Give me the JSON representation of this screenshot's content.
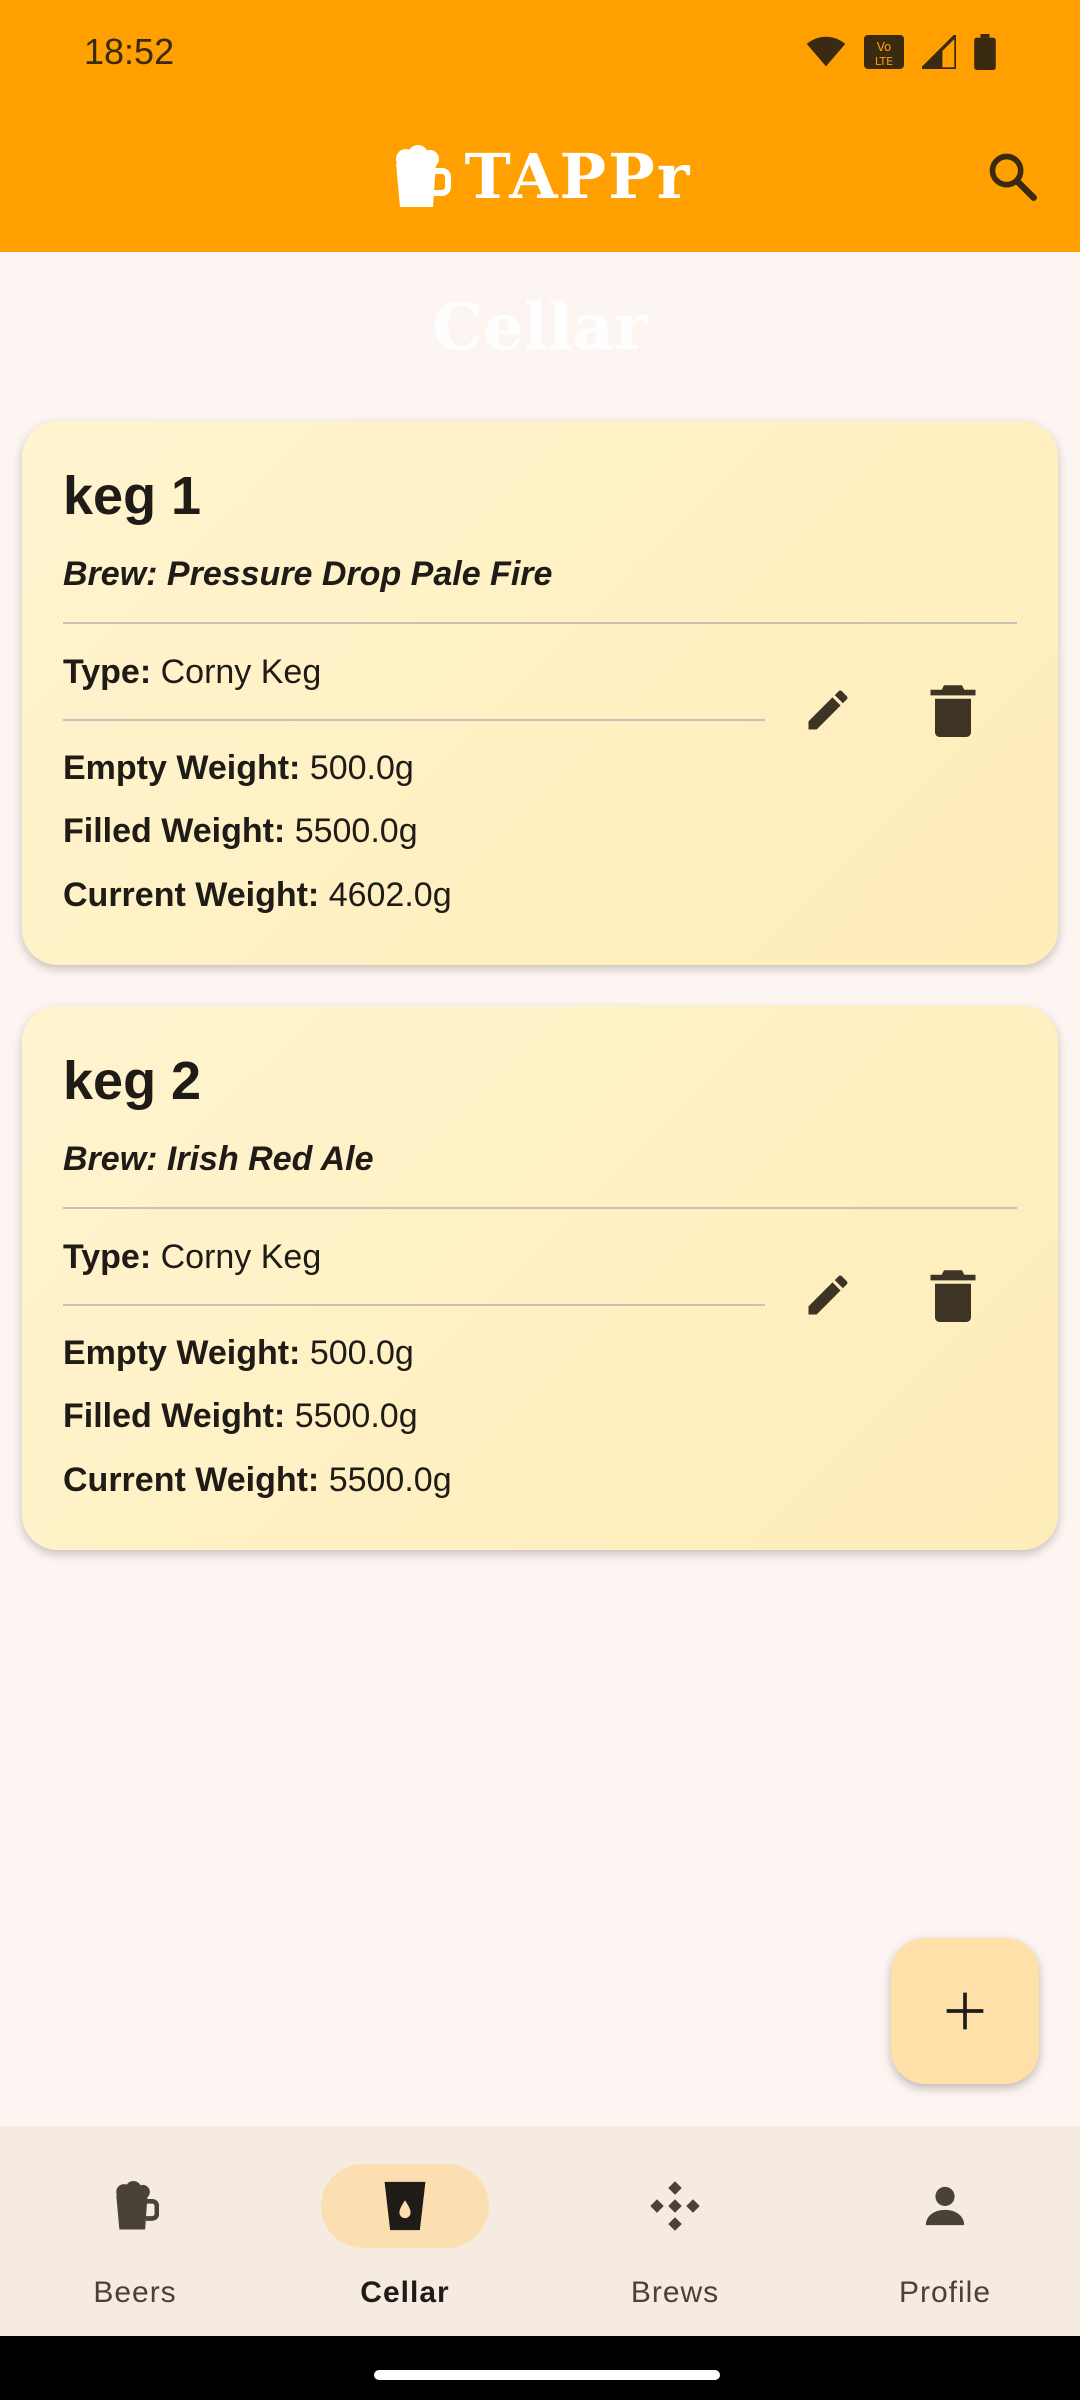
{
  "status_bar": {
    "time": "18:52"
  },
  "app": {
    "name": "TAPPr"
  },
  "page": {
    "title": "Cellar"
  },
  "kegs": [
    {
      "name": "keg 1",
      "brew": "Brew: Pressure Drop Pale Fire",
      "type_label": "Type:",
      "type_value": "Corny Keg",
      "empty_label": "Empty Weight:",
      "empty_value": "500.0g",
      "filled_label": "Filled Weight:",
      "filled_value": "5500.0g",
      "current_label": "Current Weight:",
      "current_value": "4602.0g"
    },
    {
      "name": "keg 2",
      "brew": "Brew: Irish Red Ale",
      "type_label": "Type:",
      "type_value": "Corny Keg",
      "empty_label": "Empty Weight:",
      "empty_value": "500.0g",
      "filled_label": "Filled Weight:",
      "filled_value": "5500.0g",
      "current_label": "Current Weight:",
      "current_value": "5500.0g"
    }
  ],
  "nav": [
    {
      "label": "Beers",
      "icon": "beer-mug-icon",
      "active": false
    },
    {
      "label": "Cellar",
      "icon": "cup-icon",
      "active": true
    },
    {
      "label": "Brews",
      "icon": "brew-diamond-icon",
      "active": false
    },
    {
      "label": "Profile",
      "icon": "person-icon",
      "active": false
    }
  ],
  "colors": {
    "app_bar": "#ffa000",
    "card": "#fff4cf",
    "fab": "#ffe0a8",
    "nav_bg": "#f5ebe0"
  }
}
